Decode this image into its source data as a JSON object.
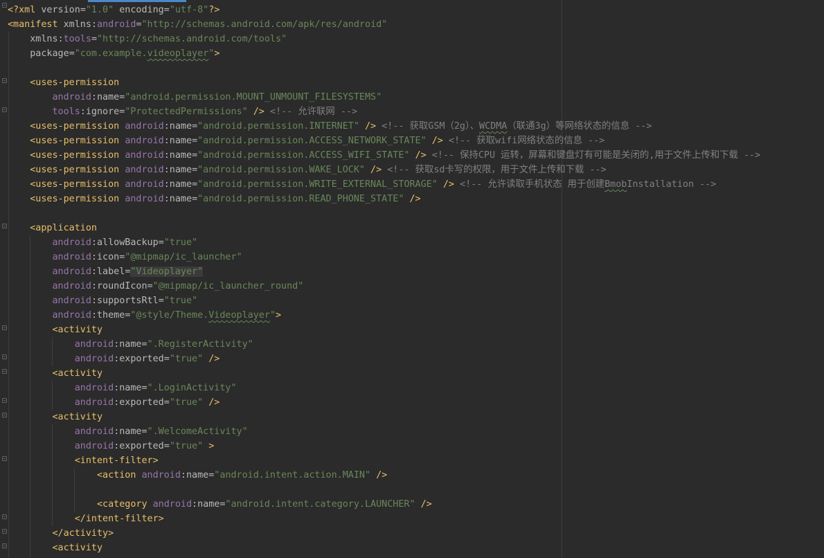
{
  "editor": {
    "file_language": "xml",
    "colors": {
      "background": "#2b2b2b",
      "tag": "#e8bf6a",
      "attribute": "#bababa",
      "namespace": "#9876aa",
      "value": "#6a8759",
      "comment": "#808080",
      "scroll_marker": "#4a88c7"
    },
    "lines": [
      [
        {
          "t": "<?xml ",
          "c": "pi"
        },
        {
          "t": "version",
          "c": "attr"
        },
        {
          "t": "=",
          "c": "attr"
        },
        {
          "t": "\"1.0\"",
          "c": "val"
        },
        {
          "t": " ",
          "c": "plain"
        },
        {
          "t": "encoding",
          "c": "attr"
        },
        {
          "t": "=",
          "c": "attr"
        },
        {
          "t": "\"utf-8\"",
          "c": "val"
        },
        {
          "t": "?>",
          "c": "pi"
        }
      ],
      [
        {
          "t": "<manifest ",
          "c": "tag"
        },
        {
          "t": "xmlns",
          "c": "attr"
        },
        {
          "t": ":",
          "c": "attr"
        },
        {
          "t": "android",
          "c": "ns"
        },
        {
          "t": "=",
          "c": "attr"
        },
        {
          "t": "\"http://schemas.android.com/apk/res/android\"",
          "c": "val"
        }
      ],
      [
        {
          "t": "    xmlns",
          "c": "attr"
        },
        {
          "t": ":",
          "c": "attr"
        },
        {
          "t": "tools",
          "c": "ns"
        },
        {
          "t": "=",
          "c": "attr"
        },
        {
          "t": "\"http://schemas.android.com/tools\"",
          "c": "val"
        }
      ],
      [
        {
          "t": "    package",
          "c": "attr"
        },
        {
          "t": "=",
          "c": "attr"
        },
        {
          "t": "\"com.example.",
          "c": "val"
        },
        {
          "t": "videoplayer",
          "c": "val warn"
        },
        {
          "t": "\"",
          "c": "val"
        },
        {
          "t": ">",
          "c": "tag"
        }
      ],
      [],
      [
        {
          "t": "    <uses-permission",
          "c": "tag"
        }
      ],
      [
        {
          "t": "        android",
          "c": "ns"
        },
        {
          "t": ":name",
          "c": "attr"
        },
        {
          "t": "=",
          "c": "attr"
        },
        {
          "t": "\"android.permission.MOUNT_UNMOUNT_FILESYSTEMS\"",
          "c": "val"
        }
      ],
      [
        {
          "t": "        tools",
          "c": "ns"
        },
        {
          "t": ":ignore",
          "c": "attr"
        },
        {
          "t": "=",
          "c": "attr"
        },
        {
          "t": "\"ProtectedPermissions\"",
          "c": "val"
        },
        {
          "t": " ",
          "c": "plain"
        },
        {
          "t": "/>",
          "c": "tag"
        },
        {
          "t": " <!-- 允许联网 -->",
          "c": "cmt"
        }
      ],
      [
        {
          "t": "    <uses-permission ",
          "c": "tag"
        },
        {
          "t": "android",
          "c": "ns"
        },
        {
          "t": ":name",
          "c": "attr"
        },
        {
          "t": "=",
          "c": "attr"
        },
        {
          "t": "\"android.permission.INTERNET\"",
          "c": "val"
        },
        {
          "t": " ",
          "c": "plain"
        },
        {
          "t": "/>",
          "c": "tag"
        },
        {
          "t": " <!-- 获取GSM（2g）、",
          "c": "cmt"
        },
        {
          "t": "WCDMA",
          "c": "cmt warn"
        },
        {
          "t": "（联通3g）等网络状态的信息 -->",
          "c": "cmt"
        }
      ],
      [
        {
          "t": "    <uses-permission ",
          "c": "tag"
        },
        {
          "t": "android",
          "c": "ns"
        },
        {
          "t": ":name",
          "c": "attr"
        },
        {
          "t": "=",
          "c": "attr"
        },
        {
          "t": "\"android.permission.ACCESS_NETWORK_STATE\"",
          "c": "val"
        },
        {
          "t": " ",
          "c": "plain"
        },
        {
          "t": "/>",
          "c": "tag"
        },
        {
          "t": " <!-- 获取wifi网络状态的信息 -->",
          "c": "cmt"
        }
      ],
      [
        {
          "t": "    <uses-permission ",
          "c": "tag"
        },
        {
          "t": "android",
          "c": "ns"
        },
        {
          "t": ":name",
          "c": "attr"
        },
        {
          "t": "=",
          "c": "attr"
        },
        {
          "t": "\"android.permission.ACCESS_WIFI_STATE\"",
          "c": "val"
        },
        {
          "t": " ",
          "c": "plain"
        },
        {
          "t": "/>",
          "c": "tag"
        },
        {
          "t": " <!-- 保持CPU 运转，屏幕和键盘灯有可能是关闭的,用于文件上传和下载 -->",
          "c": "cmt"
        }
      ],
      [
        {
          "t": "    <uses-permission ",
          "c": "tag"
        },
        {
          "t": "android",
          "c": "ns"
        },
        {
          "t": ":name",
          "c": "attr"
        },
        {
          "t": "=",
          "c": "attr"
        },
        {
          "t": "\"android.permission.WAKE_LOCK\"",
          "c": "val"
        },
        {
          "t": " ",
          "c": "plain"
        },
        {
          "t": "/>",
          "c": "tag"
        },
        {
          "t": " <!-- 获取sd卡写的权限，用于文件上传和下载 -->",
          "c": "cmt"
        }
      ],
      [
        {
          "t": "    <uses-permission ",
          "c": "tag"
        },
        {
          "t": "android",
          "c": "ns"
        },
        {
          "t": ":name",
          "c": "attr"
        },
        {
          "t": "=",
          "c": "attr"
        },
        {
          "t": "\"android.permission.WRITE_EXTERNAL_STORAGE\"",
          "c": "val"
        },
        {
          "t": " ",
          "c": "plain"
        },
        {
          "t": "/>",
          "c": "tag"
        },
        {
          "t": " <!-- 允许读取手机状态 用于创建",
          "c": "cmt"
        },
        {
          "t": "Bmob",
          "c": "cmt warn"
        },
        {
          "t": "Installation -->",
          "c": "cmt"
        }
      ],
      [
        {
          "t": "    <uses-permission ",
          "c": "tag"
        },
        {
          "t": "android",
          "c": "ns"
        },
        {
          "t": ":name",
          "c": "attr"
        },
        {
          "t": "=",
          "c": "attr"
        },
        {
          "t": "\"android.permission.READ_PHONE_STATE\"",
          "c": "val"
        },
        {
          "t": " ",
          "c": "plain"
        },
        {
          "t": "/>",
          "c": "tag"
        }
      ],
      [],
      [
        {
          "t": "    <application",
          "c": "tag"
        }
      ],
      [
        {
          "t": "        android",
          "c": "ns"
        },
        {
          "t": ":allowBackup",
          "c": "attr"
        },
        {
          "t": "=",
          "c": "attr"
        },
        {
          "t": "\"true\"",
          "c": "val"
        }
      ],
      [
        {
          "t": "        android",
          "c": "ns"
        },
        {
          "t": ":icon",
          "c": "attr"
        },
        {
          "t": "=",
          "c": "attr"
        },
        {
          "t": "\"@mipmap/ic_launcher\"",
          "c": "val"
        }
      ],
      [
        {
          "t": "        android",
          "c": "ns"
        },
        {
          "t": ":label",
          "c": "attr"
        },
        {
          "t": "=",
          "c": "attr"
        },
        {
          "t": "\"Videoplayer\"",
          "c": "val hl"
        }
      ],
      [
        {
          "t": "        android",
          "c": "ns"
        },
        {
          "t": ":roundIcon",
          "c": "attr"
        },
        {
          "t": "=",
          "c": "attr"
        },
        {
          "t": "\"@mipmap/ic_launcher_round\"",
          "c": "val"
        }
      ],
      [
        {
          "t": "        android",
          "c": "ns"
        },
        {
          "t": ":supportsRtl",
          "c": "attr"
        },
        {
          "t": "=",
          "c": "attr"
        },
        {
          "t": "\"true\"",
          "c": "val"
        }
      ],
      [
        {
          "t": "        android",
          "c": "ns"
        },
        {
          "t": ":theme",
          "c": "attr"
        },
        {
          "t": "=",
          "c": "attr"
        },
        {
          "t": "\"@style/Theme.",
          "c": "val"
        },
        {
          "t": "Videoplayer",
          "c": "val warn"
        },
        {
          "t": "\"",
          "c": "val"
        },
        {
          "t": ">",
          "c": "tag"
        }
      ],
      [
        {
          "t": "        <activity",
          "c": "tag"
        }
      ],
      [
        {
          "t": "            android",
          "c": "ns"
        },
        {
          "t": ":name",
          "c": "attr"
        },
        {
          "t": "=",
          "c": "attr"
        },
        {
          "t": "\".RegisterActivity\"",
          "c": "val"
        }
      ],
      [
        {
          "t": "            android",
          "c": "ns"
        },
        {
          "t": ":exported",
          "c": "attr"
        },
        {
          "t": "=",
          "c": "attr"
        },
        {
          "t": "\"true\"",
          "c": "val"
        },
        {
          "t": " ",
          "c": "plain"
        },
        {
          "t": "/>",
          "c": "tag"
        }
      ],
      [
        {
          "t": "        <activity",
          "c": "tag"
        }
      ],
      [
        {
          "t": "            android",
          "c": "ns"
        },
        {
          "t": ":name",
          "c": "attr"
        },
        {
          "t": "=",
          "c": "attr"
        },
        {
          "t": "\".LoginActivity\"",
          "c": "val"
        }
      ],
      [
        {
          "t": "            android",
          "c": "ns"
        },
        {
          "t": ":exported",
          "c": "attr"
        },
        {
          "t": "=",
          "c": "attr"
        },
        {
          "t": "\"true\"",
          "c": "val"
        },
        {
          "t": " ",
          "c": "plain"
        },
        {
          "t": "/>",
          "c": "tag"
        }
      ],
      [
        {
          "t": "        <activity",
          "c": "tag"
        }
      ],
      [
        {
          "t": "            android",
          "c": "ns"
        },
        {
          "t": ":name",
          "c": "attr"
        },
        {
          "t": "=",
          "c": "attr"
        },
        {
          "t": "\".WelcomeActivity\"",
          "c": "val"
        }
      ],
      [
        {
          "t": "            android",
          "c": "ns"
        },
        {
          "t": ":exported",
          "c": "attr"
        },
        {
          "t": "=",
          "c": "attr"
        },
        {
          "t": "\"true\"",
          "c": "val"
        },
        {
          "t": " ",
          "c": "plain"
        },
        {
          "t": ">",
          "c": "tag"
        }
      ],
      [
        {
          "t": "            <intent-filter>",
          "c": "tag"
        }
      ],
      [
        {
          "t": "                <action ",
          "c": "tag"
        },
        {
          "t": "android",
          "c": "ns"
        },
        {
          "t": ":name",
          "c": "attr"
        },
        {
          "t": "=",
          "c": "attr"
        },
        {
          "t": "\"android.intent.action.MAIN\"",
          "c": "val"
        },
        {
          "t": " ",
          "c": "plain"
        },
        {
          "t": "/>",
          "c": "tag"
        }
      ],
      [],
      [
        {
          "t": "                <category ",
          "c": "tag"
        },
        {
          "t": "android",
          "c": "ns"
        },
        {
          "t": ":name",
          "c": "attr"
        },
        {
          "t": "=",
          "c": "attr"
        },
        {
          "t": "\"android.intent.category.LAUNCHER\"",
          "c": "val"
        },
        {
          "t": " ",
          "c": "plain"
        },
        {
          "t": "/>",
          "c": "tag"
        }
      ],
      [
        {
          "t": "            </intent-filter>",
          "c": "tag"
        }
      ],
      [
        {
          "t": "        </activity>",
          "c": "tag"
        }
      ],
      [
        {
          "t": "        <activity",
          "c": "tag"
        }
      ]
    ]
  }
}
